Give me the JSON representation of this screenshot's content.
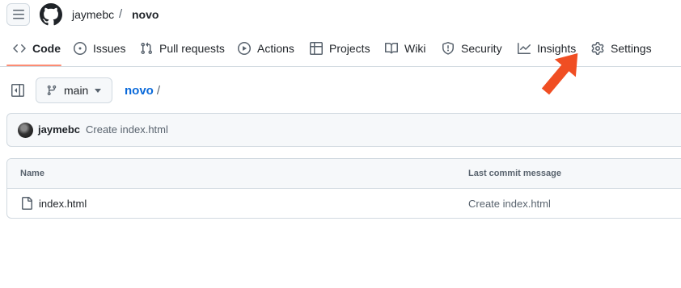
{
  "header": {
    "owner": "jaymebc",
    "separator": "/",
    "repo": "novo"
  },
  "tabs": [
    {
      "label": "Code",
      "icon": "code-icon",
      "selected": true
    },
    {
      "label": "Issues",
      "icon": "issue-icon"
    },
    {
      "label": "Pull requests",
      "icon": "pull-request-icon"
    },
    {
      "label": "Actions",
      "icon": "play-icon"
    },
    {
      "label": "Projects",
      "icon": "table-icon"
    },
    {
      "label": "Wiki",
      "icon": "book-icon"
    },
    {
      "label": "Security",
      "icon": "shield-icon"
    },
    {
      "label": "Insights",
      "icon": "graph-icon"
    },
    {
      "label": "Settings",
      "icon": "gear-icon"
    }
  ],
  "toolbar": {
    "branch": "main",
    "path_repo": "novo",
    "path_slash": "/"
  },
  "commit": {
    "author": "jaymebc",
    "message": "Create index.html"
  },
  "files": {
    "headers": {
      "name": "Name",
      "message": "Last commit message"
    },
    "rows": [
      {
        "name": "index.html",
        "message": "Create index.html"
      }
    ]
  },
  "colors": {
    "accent_underline": "#fd8c73",
    "link": "#0969da",
    "annotation_arrow": "#f04e23"
  }
}
